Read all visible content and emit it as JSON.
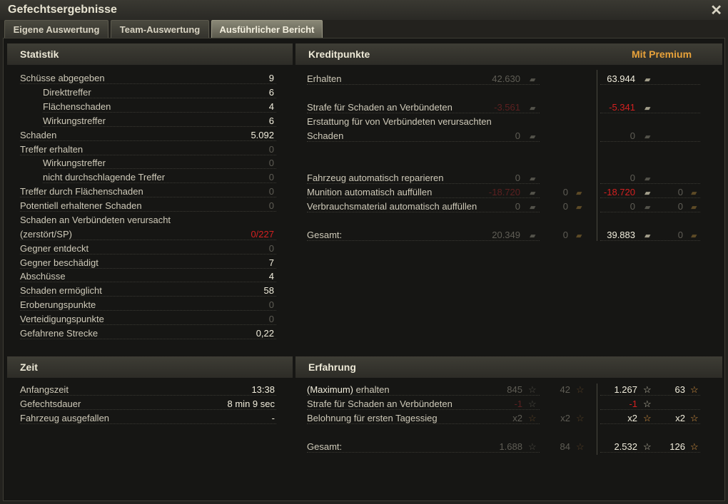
{
  "window": {
    "title": "Gefechtsergebnisse"
  },
  "tabs": [
    "Eigene Auswertung",
    "Team-Auswertung",
    "Ausführlicher Bericht"
  ],
  "active_tab": 2,
  "statistik": {
    "title": "Statistik",
    "rows": [
      {
        "label": "Schüsse abgegeben",
        "value": "9"
      },
      {
        "label": "Direkttreffer",
        "value": "6"
      },
      {
        "label": "Flächenschaden",
        "value": "4"
      },
      {
        "label": "Wirkungstreffer",
        "value": "6"
      },
      {
        "label": "Schaden",
        "value": "5.092"
      },
      {
        "label": "Treffer erhalten",
        "value": "0"
      },
      {
        "label": "Wirkungstreffer",
        "value": "0"
      },
      {
        "label": "nicht durchschlagende Treffer",
        "value": "0"
      },
      {
        "label": "Treffer durch Flächenschaden",
        "value": "0"
      },
      {
        "label": "Potentiell erhaltener Schaden",
        "value": "0"
      },
      {
        "label": "Schaden an Verbündeten verursacht",
        "value": ""
      },
      {
        "label": "(zerstört/SP)",
        "value": "0/227"
      },
      {
        "label": "Gegner entdeckt",
        "value": "0"
      },
      {
        "label": "Gegner beschädigt",
        "value": "7"
      },
      {
        "label": "Abschüsse",
        "value": "4"
      },
      {
        "label": "Schaden ermöglicht",
        "value": "58"
      },
      {
        "label": "Eroberungspunkte",
        "value": "0"
      },
      {
        "label": "Verteidigungspunkte",
        "value": "0"
      },
      {
        "label": "Gefahrene Strecke",
        "value": "0,22"
      }
    ]
  },
  "zeit": {
    "title": "Zeit",
    "rows": [
      {
        "label": "Anfangszeit",
        "value": "13:38"
      },
      {
        "label": "Gefechtsdauer",
        "value": "8 min 9 sec"
      },
      {
        "label": "Fahrzeug ausgefallen",
        "value": "-"
      }
    ]
  },
  "kreditpunkte": {
    "title": "Kreditpunkte",
    "premium_label": "Mit Premium",
    "rows": [
      {
        "label": "Erhalten",
        "std_credits": "42.630",
        "prem_credits": "63.944"
      },
      {
        "label": "Strafe für Schaden an Verbündeten",
        "std_credits": "-3.561",
        "prem_credits": "-5.341"
      },
      {
        "label": "Erstattung für von Verbündeten verursachten"
      },
      {
        "label": "Schaden",
        "std_credits": "0",
        "prem_credits": "0"
      },
      {
        "label": "Fahrzeug automatisch reparieren",
        "std_credits": "0",
        "prem_credits": "0"
      },
      {
        "label": "Munition automatisch auffüllen",
        "std_credits": "-18.720",
        "std_gold": "0",
        "prem_credits": "-18.720",
        "prem_gold": "0"
      },
      {
        "label": "Verbrauchsmaterial automatisch auffüllen",
        "std_credits": "0",
        "std_gold": "0",
        "prem_credits": "0",
        "prem_gold": "0"
      },
      {
        "label": "Gesamt:",
        "std_credits": "20.349",
        "std_gold": "0",
        "prem_credits": "39.883",
        "prem_gold": "0"
      }
    ]
  },
  "erfahrung": {
    "title": "Erfahrung",
    "rows": [
      {
        "label_bold": "(Maximum)",
        "label": " erhalten",
        "std_xp": "845",
        "std_free": "42",
        "prem_xp": "1.267",
        "prem_free": "63"
      },
      {
        "label": "Strafe für Schaden an Verbündeten",
        "std_xp": "-1",
        "prem_xp": "-1"
      },
      {
        "label": "Belohnung für ersten Tagessieg",
        "std_xp": "x2",
        "std_free": "x2",
        "prem_xp": "x2",
        "prem_free": "x2"
      },
      {
        "label": "Gesamt:",
        "std_xp": "1.688",
        "std_free": "84",
        "prem_xp": "2.532",
        "prem_free": "126"
      }
    ]
  },
  "icons": {
    "credit": "credit-coin-icon",
    "gold": "gold-coin-icon",
    "xp": "experience-star-icon",
    "free_xp": "free-experience-star-icon",
    "close": "close-icon"
  }
}
